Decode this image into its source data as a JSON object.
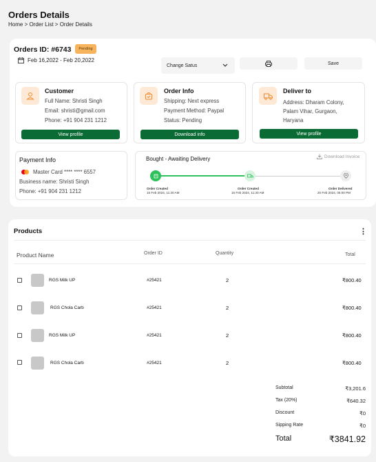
{
  "page": {
    "title": "Orders Details",
    "breadcrumb": "Home > Order List > Order Details"
  },
  "order": {
    "id_label": "Orders ID: #6743",
    "status": "Pending",
    "date_range": "Feb 16,2022 - Feb 20,2022"
  },
  "toolbar": {
    "status_select": "Change Satus",
    "save_label": "Save"
  },
  "customer": {
    "title": "Customer",
    "lines": [
      "Full Name: Shristi Singh",
      "Email: shristi@gmail.com",
      "Phone: +91 904 231 1212"
    ],
    "button": "View profile"
  },
  "order_info": {
    "title": "Order Info",
    "lines": [
      "Shipping: Next express",
      "Payment Method: Paypal",
      "Status: Pending"
    ],
    "button": "Download info"
  },
  "deliver": {
    "title": "Deliver to",
    "lines": [
      "Address: Dharam Colony,",
      "Palam Vihar, Gurgaon,",
      "Haryana"
    ],
    "button": "View profile"
  },
  "payment": {
    "title": "Payment Info",
    "card": "Master Card **** **** 6557",
    "business": "Business name: Shristi Singh",
    "phone": "Phone: +91 904 231 1212"
  },
  "tracking": {
    "title": "Bought - Awaiting Delivery",
    "download": "Download Invoice",
    "progress": 0.5,
    "steps": [
      {
        "label": "Order Created",
        "date": "15 Feb 2024, 11:30 AM"
      },
      {
        "label": "Order Created",
        "date": "15 Feb 2024, 11:30 AM"
      },
      {
        "label": "Order Delivered",
        "date": "20 Feb 2024, 05:00 PM"
      }
    ]
  },
  "products": {
    "title": "Products",
    "columns": {
      "name": "Product Name",
      "order_id": "Order ID",
      "quantity": "Quantity",
      "total": "Total"
    },
    "rows": [
      {
        "name": "RGS Milk UP",
        "order_id": "#25421",
        "quantity": "2",
        "total": "₹800.40"
      },
      {
        "name": "RGS Chola Carb",
        "order_id": "#25421",
        "quantity": "2",
        "total": "₹800.40"
      },
      {
        "name": "RGS Milk UP",
        "order_id": "#25421",
        "quantity": "2",
        "total": "₹800.40"
      },
      {
        "name": "RGS Chola Carb",
        "order_id": "#25421",
        "quantity": "2",
        "total": "₹800.40"
      }
    ]
  },
  "summary": {
    "subtotal_label": "Subtotal",
    "subtotal": "₹3,201.6",
    "tax_label": "Tax (20%)",
    "tax": "₹640.32",
    "discount_label": "Discount",
    "discount": "₹0",
    "shipping_label": "Sipping Rate",
    "shipping": "₹0",
    "total_label": "Total",
    "total": "₹3841.92"
  },
  "colors": {
    "accent_green": "#0b6b34",
    "pending": "#f8b45c",
    "progress_green": "#2ec05a",
    "icon_bg": "#fde9d6",
    "icon_fg": "#f08a2c"
  }
}
